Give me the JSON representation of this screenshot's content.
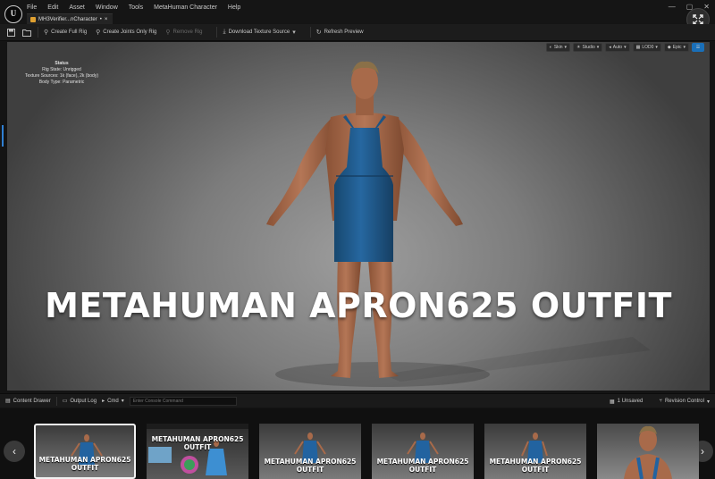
{
  "app": {
    "menu": [
      "File",
      "Edit",
      "Asset",
      "Window",
      "Tools",
      "MetaHuman Character",
      "Help"
    ],
    "tab_label": "MH3Verifier...nCharacter",
    "tab_modified": "•",
    "tab_close": "×",
    "window_controls": [
      "—",
      "▢",
      "✕"
    ]
  },
  "toolbar": {
    "buttons": [
      {
        "label": "Create Full Rig",
        "icon": "rig-icon",
        "enabled": true
      },
      {
        "label": "Create Joints Only Rig",
        "icon": "joints-icon",
        "enabled": true
      },
      {
        "label": "Remove Rig",
        "icon": "remove-rig-icon",
        "enabled": false
      },
      {
        "label": "Download Texture Source",
        "icon": "download-icon",
        "enabled": true,
        "has_dropdown": true
      },
      {
        "label": "Refresh Preview",
        "icon": "refresh-icon",
        "enabled": true
      }
    ]
  },
  "viewport": {
    "controls": [
      "Skin",
      "Studio",
      "Auto",
      "LOD0",
      "Epic"
    ],
    "status": {
      "title": "Status",
      "rig_state": "Rig State: Unrigged",
      "texture_sources": "Texture Sources: 1k (face), 2k (body)",
      "body_type": "Body Type: Parametric"
    },
    "overlay_title": "METAHUMAN APRON625 OUTFIT",
    "colors": {
      "apron": "#1f5a8c",
      "skin": "#a86a4a",
      "background": "#7c7c7c"
    }
  },
  "bottombar": {
    "content_drawer": "Content Drawer",
    "output_log": "Output Log",
    "cmd": "Cmd",
    "console_placeholder": "Enter Console Command",
    "unsaved": "1 Unsaved",
    "revision_control": "Revision Control"
  },
  "thumbnails": [
    {
      "caption": "METAHUMAN APRON625 OUTFIT",
      "caption_pos": "bottom",
      "selected": true
    },
    {
      "caption": "METAHUMAN APRON625 OUTFIT",
      "caption_pos": "top",
      "selected": false
    },
    {
      "caption": "METAHUMAN APRON625 OUTFIT",
      "caption_pos": "bottom",
      "selected": false
    },
    {
      "caption": "METAHUMAN APRON625 OUTFIT",
      "caption_pos": "bottom",
      "selected": false
    },
    {
      "caption": "METAHUMAN APRON625 OUTFIT",
      "caption_pos": "bottom",
      "selected": false
    },
    {
      "caption": "",
      "caption_pos": "none",
      "selected": false
    }
  ],
  "strip_nav": {
    "prev": "‹",
    "next": "›"
  }
}
